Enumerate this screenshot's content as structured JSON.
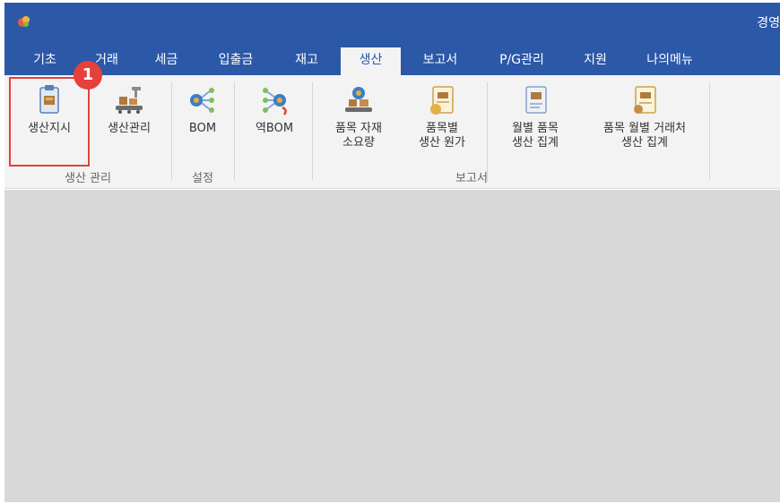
{
  "titlebar": {
    "right_text": "경영"
  },
  "tabs": [
    {
      "label": "기초"
    },
    {
      "label": "거래"
    },
    {
      "label": "세금"
    },
    {
      "label": "입출금"
    },
    {
      "label": "재고"
    },
    {
      "label": "생산",
      "active": true
    },
    {
      "label": "보고서"
    },
    {
      "label": "P/G관리"
    },
    {
      "label": "지원"
    },
    {
      "label": "나의메뉴"
    }
  ],
  "ribbon": {
    "buttons": {
      "production_order": {
        "label": "생산지시",
        "icon": "clipboard-icon"
      },
      "production_manage": {
        "label": "생산관리",
        "icon": "conveyor-icon"
      },
      "bom": {
        "label": "BOM",
        "icon": "tree-icon"
      },
      "reverse_bom": {
        "label": "역BOM",
        "icon": "reverse-tree-icon"
      },
      "material_usage": {
        "label": "품목 자재\n소요량",
        "icon": "material-icon"
      },
      "production_cost": {
        "label": "품목별\n생산 원가",
        "icon": "cost-report-icon"
      },
      "monthly_summary": {
        "label": "월별 품목\n생산 집계",
        "icon": "monthly-report-icon"
      },
      "vendor_summary": {
        "label": "품목 월별 거래처\n생산 집계",
        "icon": "vendor-report-icon"
      }
    },
    "groups": {
      "production": "생산 관리",
      "settings": "설정",
      "reports": "보고서"
    }
  },
  "annotation": {
    "marker": "1"
  },
  "colors": {
    "accent": "#2c58a8",
    "highlight": "#e5403a"
  }
}
